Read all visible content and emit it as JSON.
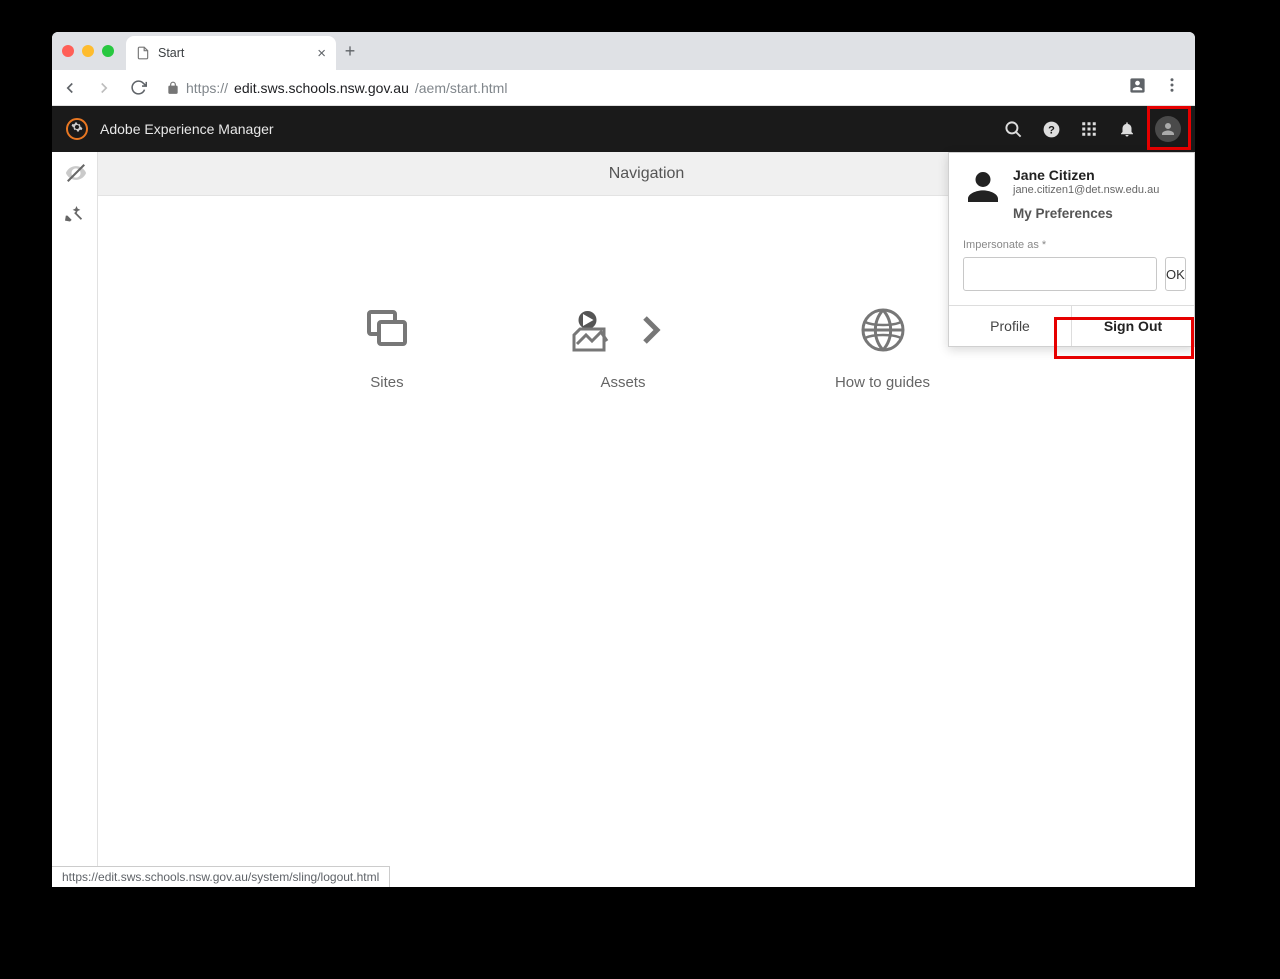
{
  "browser": {
    "tab_title": "Start",
    "url_domain": "edit.sws.schools.nsw.gov.au",
    "url_prefix": "https://",
    "url_path": "/aem/start.html",
    "status_url": "https://edit.sws.schools.nsw.gov.au/system/sling/logout.html"
  },
  "aem": {
    "title": "Adobe Experience Manager",
    "nav_header": "Navigation",
    "items": [
      {
        "label": "Sites"
      },
      {
        "label": "Assets"
      },
      {
        "label": "How to guides"
      }
    ]
  },
  "user": {
    "name": "Jane Citizen",
    "email": "jane.citizen1@det.nsw.edu.au",
    "prefs_label": "My Preferences",
    "impersonate_label": "Impersonate as *",
    "ok_label": "OK",
    "profile_label": "Profile",
    "signout_label": "Sign Out"
  }
}
